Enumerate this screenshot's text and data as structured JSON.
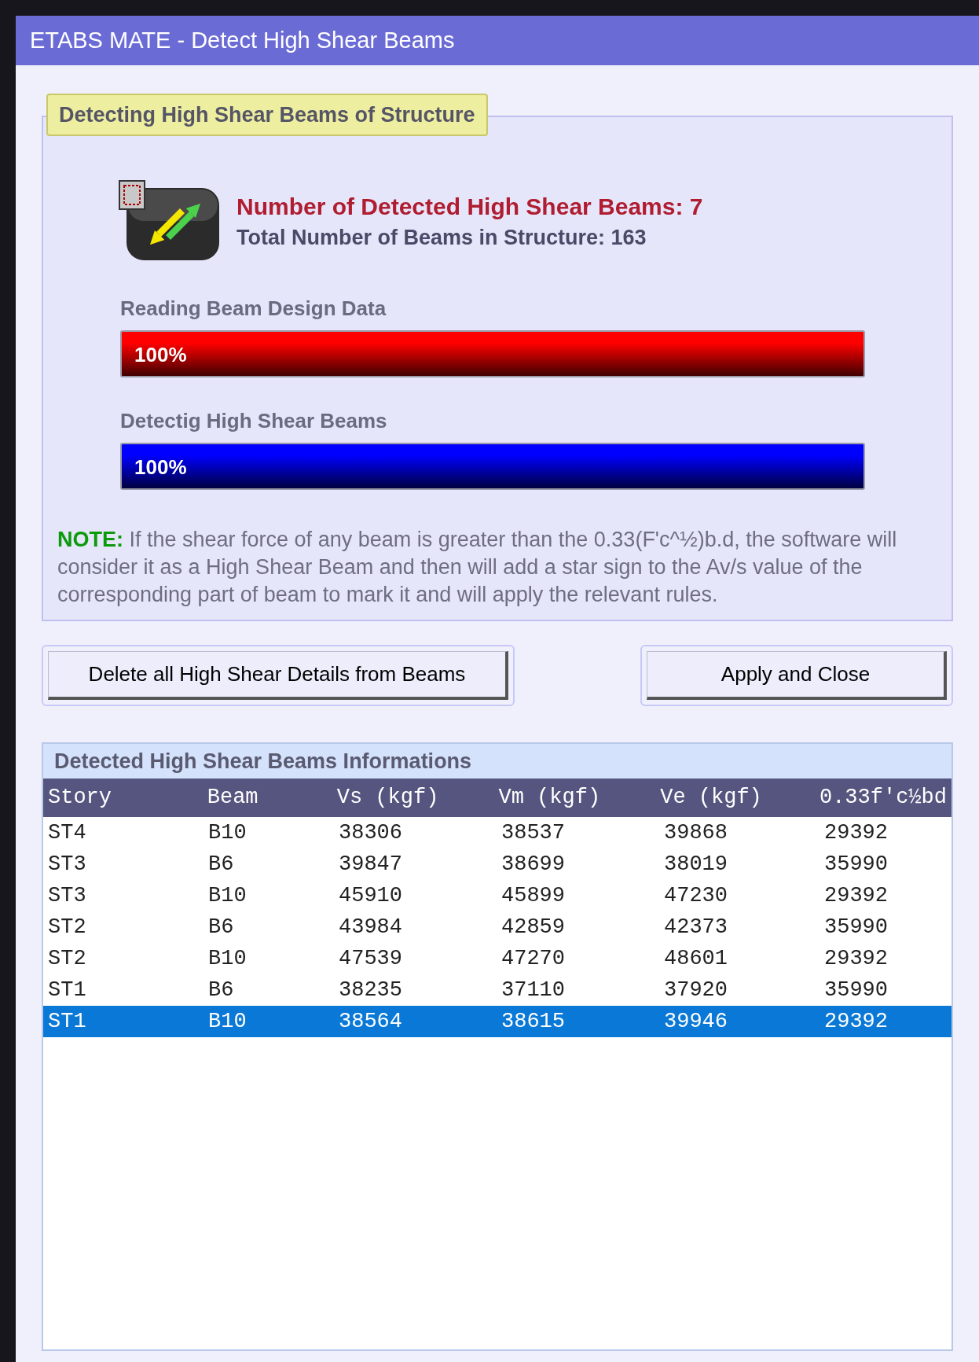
{
  "window": {
    "title": "ETABS MATE - Detect High Shear Beams"
  },
  "detection": {
    "label": "Detecting High Shear Beams of Structure",
    "detected": "Number of Detected High Shear Beams: 7",
    "total": "Total Number of Beams in Structure: 163",
    "progress": [
      {
        "label": "Reading Beam Design Data",
        "level": 1,
        "reading": "100%",
        "color": "#ff0000"
      },
      {
        "label": "Detectig High Shear Beams",
        "level": 1,
        "reading": "100%",
        "color": "#0000ff"
      }
    ],
    "note": "**NOTE:** If the shear force of any beam is greater than the 0.33(F'c^½)b.d, the software will consider it as a High Shear Beam and then will add a star sign to the Av/s value of the corresponding part of beam to mark it and will apply the relevant rules."
  },
  "buttons": [
    {
      "label": "Delete all High Shear Details from Beams"
    },
    {
      "label": "Apply and Close"
    }
  ],
  "table": {
    "title": "Detected High Shear Beams Informations",
    "columns": [
      "Story",
      "Beam",
      "Vs (kgf)",
      "Vm (kgf)",
      "Ve (kgf)",
      "0.33f'c½bd"
    ],
    "rows": [
      {
        "cells": [
          "ST4",
          "B10",
          "38306",
          "38537",
          "39868",
          "29392"
        ],
        "selected": false
      },
      {
        "cells": [
          "ST3",
          "B6",
          "39847",
          "38699",
          "38019",
          "35990"
        ],
        "selected": false
      },
      {
        "cells": [
          "ST3",
          "B10",
          "45910",
          "45899",
          "47230",
          "29392"
        ],
        "selected": false
      },
      {
        "cells": [
          "ST2",
          "B6",
          "43984",
          "42859",
          "42373",
          "35990"
        ],
        "selected": false
      },
      {
        "cells": [
          "ST2",
          "B10",
          "47539",
          "47270",
          "48601",
          "29392"
        ],
        "selected": false
      },
      {
        "cells": [
          "ST1",
          "B6",
          "38235",
          "37110",
          "37920",
          "35990"
        ],
        "selected": false
      },
      {
        "cells": [
          "ST1",
          "B10",
          "38564",
          "38615",
          "39946",
          "29392"
        ],
        "selected": true
      }
    ]
  }
}
